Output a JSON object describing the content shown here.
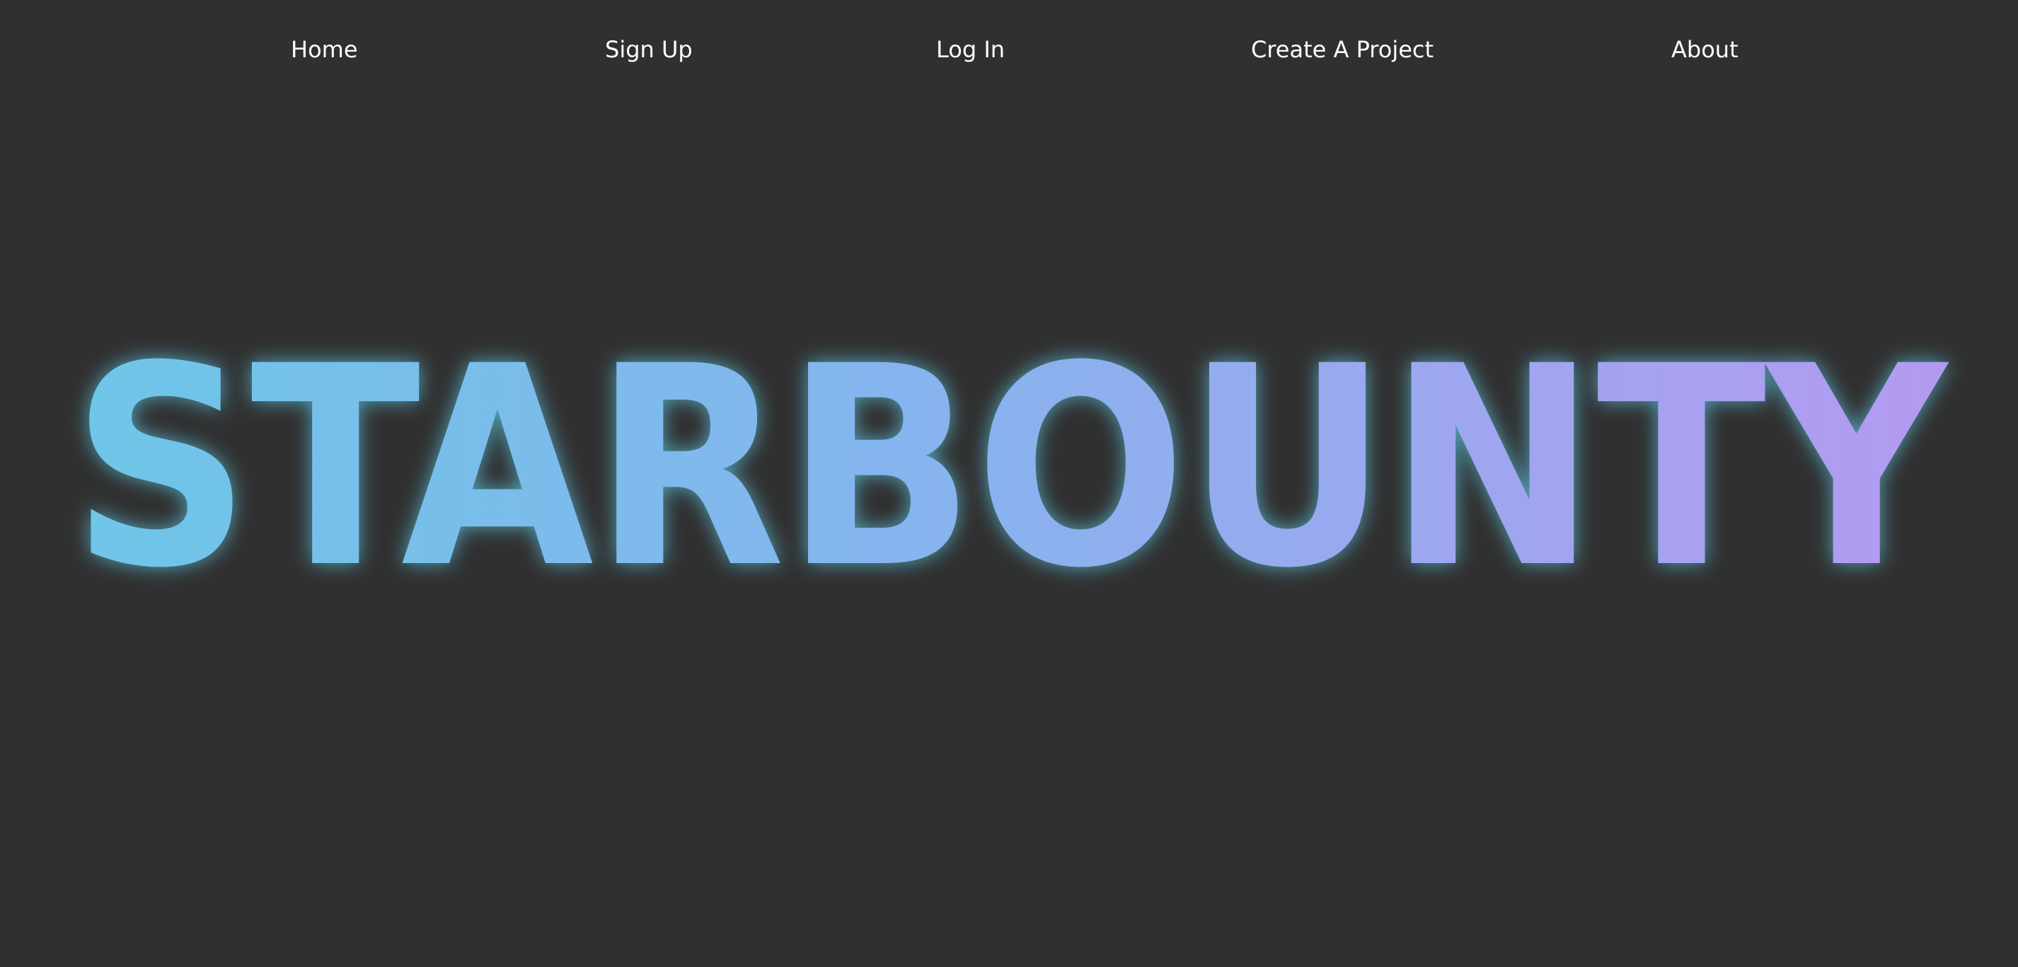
{
  "page": {
    "background_color": "#303030"
  },
  "nav": {
    "items": [
      {
        "label": "Home"
      },
      {
        "label": "Sign Up"
      },
      {
        "label": "Log In"
      },
      {
        "label": "Create A Project"
      },
      {
        "label": "About"
      }
    ],
    "text_color": "#ffffff"
  },
  "hero": {
    "title": "STARBOUNTY",
    "gradient_colors": [
      "#6ec6e8",
      "#86b4ee",
      "#b39af0"
    ],
    "glow_color": "#5ecbe8"
  }
}
